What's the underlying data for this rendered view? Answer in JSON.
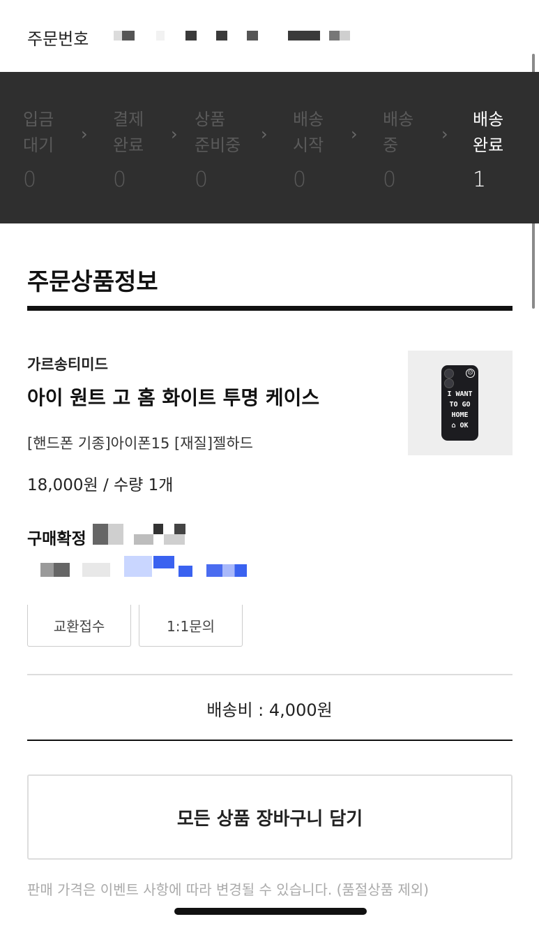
{
  "order": {
    "label": "주문번호"
  },
  "status_steps": [
    {
      "label": "입금\n대기",
      "count": "0",
      "active": false
    },
    {
      "label": "결제\n완료",
      "count": "0",
      "active": false
    },
    {
      "label": "상품\n준비중",
      "count": "0",
      "active": false
    },
    {
      "label": "배송\n시작",
      "count": "0",
      "active": false
    },
    {
      "label": "배송\n중",
      "count": "0",
      "active": false
    },
    {
      "label": "배송\n완료",
      "count": "1",
      "active": true
    }
  ],
  "chevron_glyph": "›",
  "section": {
    "title": "주문상품정보"
  },
  "product": {
    "brand": "가르송티미드",
    "name": "아이 원트 고 홈 화이트 투명 케이스",
    "option": "[핸드폰 기종]아이폰15 [재질]젤하드",
    "price_qty": "18,000원 / 수량 1개",
    "thumbnail_text": "I WANT\nTO GO\nHOME\n⌂ OK"
  },
  "purchase": {
    "confirm_label": "구매확정"
  },
  "actions": {
    "exchange_label": "교환접수",
    "inquiry_label": "1:1문의"
  },
  "shipping": {
    "fee_text": "배송비 : 4,000원"
  },
  "cart": {
    "add_all_label": "모든 상품 장바구니 담기"
  },
  "notice": {
    "text": "판매 가격은 이벤트 사항에 따라 변경될 수 있습니다. (품절상품 제외)"
  },
  "colors": {
    "status_bg": "#2f2f2f",
    "inactive_step": "#5a5a5a",
    "active_step": "#ffffff",
    "redaction_blue": "#3a62f0"
  }
}
